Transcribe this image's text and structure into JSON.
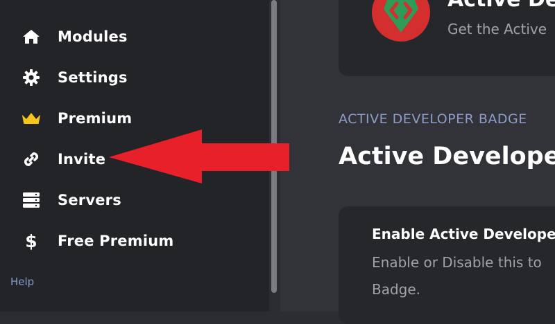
{
  "sidebar": {
    "items": [
      {
        "label": "Modules",
        "icon": "home-icon"
      },
      {
        "label": "Settings",
        "icon": "gear-icon"
      },
      {
        "label": "Premium",
        "icon": "crown-icon"
      },
      {
        "label": "Invite",
        "icon": "link-icon"
      },
      {
        "label": "Servers",
        "icon": "server-icon"
      },
      {
        "label": "Free Premium",
        "icon": "dollar-icon"
      }
    ],
    "section_label": "Help"
  },
  "header": {
    "title": "Active De",
    "subtitle": "Get the Active"
  },
  "main": {
    "eyebrow": "ACTIVE DEVELOPER BADGE",
    "title": "Active Developer",
    "setting": {
      "title": "Enable Active Developer",
      "description": "Enable or Disable this to Badge."
    }
  },
  "annotation": {
    "arrow_color": "#e8202a",
    "points_to": "Invite"
  },
  "colors": {
    "accent": "#f5c518",
    "muted_blue": "#8e9cc7"
  }
}
